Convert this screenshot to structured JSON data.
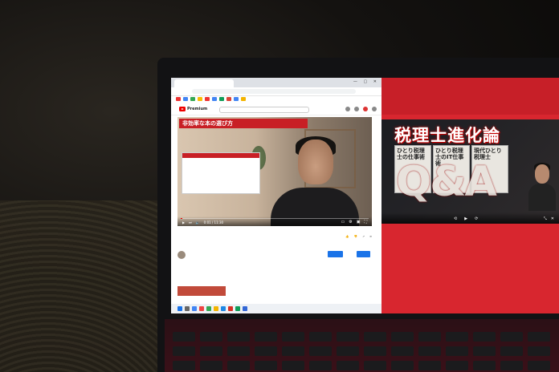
{
  "browser": {
    "win_controls": "—  ▢  ✕"
  },
  "youtube": {
    "brand": "Premium"
  },
  "player": {
    "banner_title": "非効率な本の選び方",
    "time": "0:01 / 11:30"
  },
  "right_panel": {
    "title": "税理士進化論",
    "qa_text": "Q&A",
    "book1": "ひとり税理士の仕事術",
    "book2": "ひとり税理士のIT仕事術",
    "book3": "現代ひとり税理士"
  },
  "colors": {
    "youtube_red": "#e00000",
    "banner_red": "#c81f25",
    "panel_red": "#d8262f",
    "button_blue": "#1a73e8"
  },
  "icons": [
    "youtube-play-icon",
    "play-icon",
    "next-icon",
    "volume-icon",
    "settings-icon",
    "fullscreen-icon"
  ]
}
